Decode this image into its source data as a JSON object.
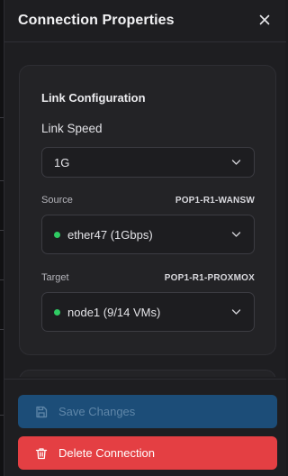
{
  "dialog": {
    "title": "Connection Properties",
    "close_icon": "close-icon"
  },
  "link_configuration": {
    "heading": "Link Configuration",
    "link_speed": {
      "label": "Link Speed",
      "value": "1G"
    },
    "source": {
      "label": "Source",
      "device": "POP1-R1-WANSW",
      "port": "ether47 (1Gbps)",
      "status_color": "#2fcb63"
    },
    "target": {
      "label": "Target",
      "device": "POP1-R1-PROXMOX",
      "port": "node1 (9/14 VMs)",
      "status_color": "#2fcb63"
    }
  },
  "footer": {
    "save_label": "Save Changes",
    "save_icon": "save-icon",
    "delete_label": "Delete Connection",
    "delete_icon": "trash-icon"
  },
  "colors": {
    "save_button": "#1c4d78",
    "delete_button": "#e43f43",
    "status_online": "#2fcb63"
  }
}
